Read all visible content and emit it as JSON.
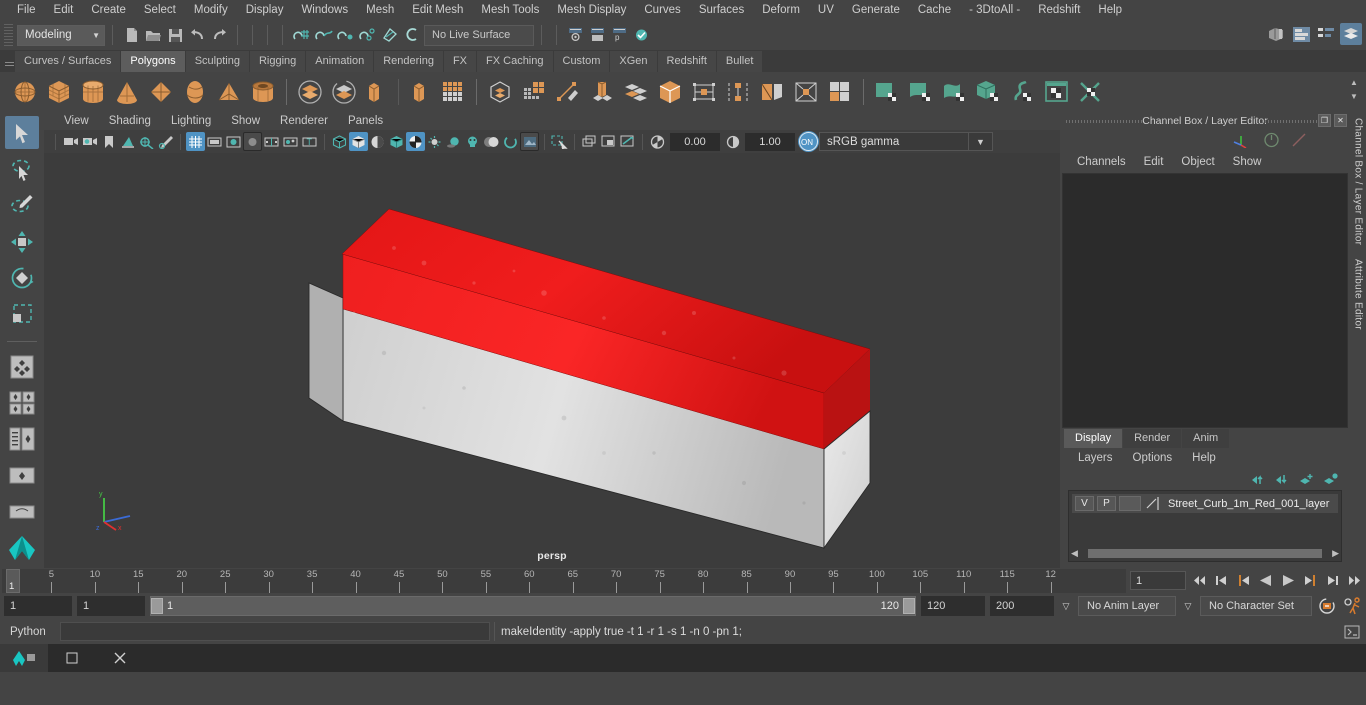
{
  "menubar": {
    "items": [
      "File",
      "Edit",
      "Create",
      "Select",
      "Modify",
      "Display",
      "Windows",
      "Mesh",
      "Edit Mesh",
      "Mesh Tools",
      "Mesh Display",
      "Curves",
      "Surfaces",
      "Deform",
      "UV",
      "Generate",
      "Cache",
      "- 3DtoAll -",
      "Redshift",
      "Help"
    ]
  },
  "statusbar": {
    "mode": "Modeling",
    "live_surface": "No Live Surface"
  },
  "shelf_tabs": {
    "items": [
      "Curves / Surfaces",
      "Polygons",
      "Sculpting",
      "Rigging",
      "Animation",
      "Rendering",
      "FX",
      "FX Caching",
      "Custom",
      "XGen",
      "Redshift",
      "Bullet"
    ],
    "active": "Polygons"
  },
  "shelf_icons": [
    {
      "name": "poly-sphere-icon",
      "group": "prim"
    },
    {
      "name": "poly-cube-icon",
      "group": "prim"
    },
    {
      "name": "poly-cylinder-icon",
      "group": "prim"
    },
    {
      "name": "poly-cone-icon",
      "group": "prim"
    },
    {
      "name": "poly-plane-icon",
      "group": "prim"
    },
    {
      "name": "poly-torus-icon",
      "group": "prim"
    },
    {
      "name": "poly-pyramid-icon",
      "group": "prim"
    },
    {
      "name": "poly-pipe-icon",
      "group": "prim"
    },
    {
      "name": "boolean-union-icon",
      "group": "bool"
    },
    {
      "name": "boolean-difference-icon",
      "group": "bool"
    },
    {
      "name": "combine-icon",
      "group": "bool"
    },
    {
      "name": "separate-icon",
      "group": "bool"
    },
    {
      "name": "multi-cut-grid-icon",
      "group": "bool"
    },
    {
      "name": "smooth-icon",
      "group": "edit"
    },
    {
      "name": "poly-quad-draw-icon",
      "group": "edit"
    },
    {
      "name": "multi-cut-tool-icon",
      "group": "edit"
    },
    {
      "name": "extrude-icon",
      "group": "edit"
    },
    {
      "name": "bevel-icon",
      "group": "edit"
    },
    {
      "name": "bridge-icon",
      "group": "edit"
    },
    {
      "name": "append-polygon-icon",
      "group": "edit"
    },
    {
      "name": "insert-edge-loop-icon",
      "group": "edit"
    },
    {
      "name": "mirror-geometry-icon",
      "group": "edit"
    },
    {
      "name": "uv-planar-icon",
      "group": "edit"
    },
    {
      "name": "sculpt-target-icon",
      "group": "edit"
    },
    {
      "name": "uv-plane-icon",
      "group": "uv"
    },
    {
      "name": "uv-cylinder-icon",
      "group": "uv"
    },
    {
      "name": "uv-sphere-icon",
      "group": "uv"
    },
    {
      "name": "uv-automatic-icon",
      "group": "uv"
    },
    {
      "name": "uv-unfold-icon",
      "group": "uv"
    },
    {
      "name": "uv-editor-icon",
      "group": "uv"
    },
    {
      "name": "uv-cut-sew-icon",
      "group": "uv"
    }
  ],
  "left_tools": [
    {
      "name": "select-tool",
      "selected": true
    },
    {
      "name": "lasso-select-tool",
      "selected": false
    },
    {
      "name": "paint-select-tool",
      "selected": false
    },
    {
      "name": "move-tool",
      "selected": false
    },
    {
      "name": "rotate-tool",
      "selected": false
    },
    {
      "name": "scale-tool",
      "selected": false
    },
    {
      "name": "last-tool",
      "selected": false
    },
    {
      "name": "four-view-layout",
      "selected": false
    },
    {
      "name": "outliner-persp-layout",
      "selected": false
    },
    {
      "name": "persp-graph-layout",
      "selected": false
    },
    {
      "name": "single-perspective-layout",
      "selected": false
    },
    {
      "name": "maya-logo-icon",
      "selected": false
    }
  ],
  "viewport": {
    "menu": [
      "View",
      "Shading",
      "Lighting",
      "Show",
      "Renderer",
      "Panels"
    ],
    "exposure": "0.00",
    "gamma_value": "1.00",
    "color_space": "sRGB gamma",
    "camera_label": "persp",
    "toolbar_icons": [
      "select-camera-icon",
      "camera-attributes-icon",
      "bookmark-icon",
      "image-plane-icon",
      "two-d-pan-zoom-icon",
      "oil-paint-icon",
      "grid-toggle-icon",
      "film-gate-icon",
      "resolution-gate-icon",
      "gate-mask-icon",
      "field-chart-icon",
      "safe-action-icon",
      "title-safe-icon",
      "wireframe-icon",
      "smooth-shade-icon",
      "shaded-wireframe-icon",
      "textured-icon",
      "checker-texture-icon",
      "use-lights-icon",
      "shadows-icon",
      "screen-space-ao-icon",
      "motion-blur-icon",
      "multisample-icon",
      "isolate-select-icon",
      "xray-icon",
      "xray-joints-icon",
      "xray-active-components-icon",
      "exposure-icon",
      "gamma-icon",
      "view-transform-icon"
    ]
  },
  "channel_box": {
    "title": "Channel Box / Layer Editor",
    "menu": [
      "Channels",
      "Edit",
      "Object",
      "Show"
    ],
    "side_labels": [
      "Channel Box / Layer Editor",
      "Attribute Editor"
    ]
  },
  "layer_editor": {
    "tabs": [
      "Display",
      "Render",
      "Anim"
    ],
    "active_tab": "Display",
    "menu": [
      "Layers",
      "Options",
      "Help"
    ],
    "buttons": [
      "move-layer-up-icon",
      "move-layer-down-icon",
      "new-layer-icon",
      "new-layer-from-selected-icon"
    ],
    "layers": [
      {
        "visibility": "V",
        "playback": "P",
        "name": "Street_Curb_1m_Red_001_layer"
      }
    ]
  },
  "timeline": {
    "labels": [
      "5",
      "10",
      "15",
      "20",
      "25",
      "30",
      "35",
      "40",
      "45",
      "50",
      "55",
      "60",
      "65",
      "70",
      "75",
      "80",
      "85",
      "90",
      "95",
      "100",
      "105",
      "110",
      "115",
      "12"
    ],
    "start": 1,
    "end": 120,
    "current_frame": "1",
    "current_frame_field": "1",
    "playback_buttons": [
      "go-to-start-icon",
      "step-back-keyframe-icon",
      "step-back-frame-icon",
      "play-backwards-icon",
      "play-forwards-icon",
      "step-forward-frame-icon",
      "step-forward-keyframe-icon",
      "go-to-end-icon"
    ]
  },
  "range": {
    "anim_start": "1",
    "range_start": "1",
    "slider_start_label": "1",
    "slider_end_label": "120",
    "range_end": "120",
    "anim_end": "200",
    "anim_layer": "No Anim Layer",
    "character_set": "No Character Set",
    "icons": [
      "auto-key-icon",
      "animation-preferences-icon"
    ]
  },
  "command_line": {
    "language": "Python",
    "input_value": "",
    "output": "makeIdentity -apply true -t 1 -r 1 -s 1 -n 0 -pn 1;"
  },
  "right_status_icons": [
    "modeling-toolkit-icon",
    "attribute-editor-icon",
    "tool-settings-icon",
    "channel-box-icon"
  ],
  "taskbar": {
    "items": [
      "maya-app-icon",
      "window-restore-icon",
      "close-icon"
    ]
  },
  "colors": {
    "accent_blue": "#5d7f9c",
    "orange": "#e0944d",
    "teal": "#4fb6b0",
    "model_red": "#e81d1d",
    "model_grey": "#d8d8d8",
    "panel_bg": "#444444",
    "viewport_bg": "#3c3c3c"
  }
}
